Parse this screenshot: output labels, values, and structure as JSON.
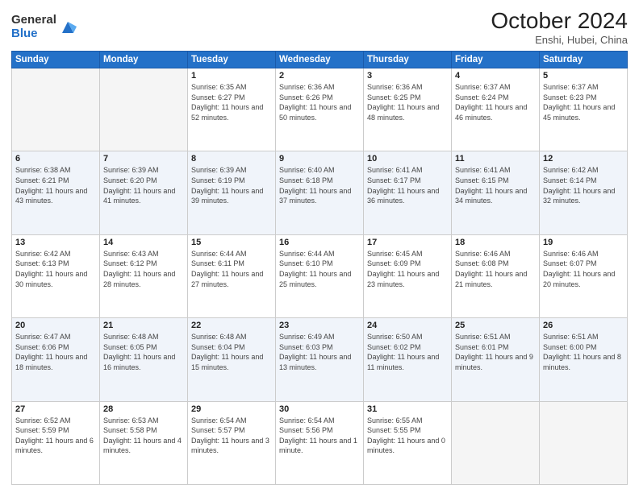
{
  "header": {
    "logo_general": "General",
    "logo_blue": "Blue",
    "title": "October 2024",
    "location": "Enshi, Hubei, China"
  },
  "weekdays": [
    "Sunday",
    "Monday",
    "Tuesday",
    "Wednesday",
    "Thursday",
    "Friday",
    "Saturday"
  ],
  "weeks": [
    [
      {
        "day": "",
        "info": ""
      },
      {
        "day": "",
        "info": ""
      },
      {
        "day": "1",
        "info": "Sunrise: 6:35 AM\nSunset: 6:27 PM\nDaylight: 11 hours and 52 minutes."
      },
      {
        "day": "2",
        "info": "Sunrise: 6:36 AM\nSunset: 6:26 PM\nDaylight: 11 hours and 50 minutes."
      },
      {
        "day": "3",
        "info": "Sunrise: 6:36 AM\nSunset: 6:25 PM\nDaylight: 11 hours and 48 minutes."
      },
      {
        "day": "4",
        "info": "Sunrise: 6:37 AM\nSunset: 6:24 PM\nDaylight: 11 hours and 46 minutes."
      },
      {
        "day": "5",
        "info": "Sunrise: 6:37 AM\nSunset: 6:23 PM\nDaylight: 11 hours and 45 minutes."
      }
    ],
    [
      {
        "day": "6",
        "info": "Sunrise: 6:38 AM\nSunset: 6:21 PM\nDaylight: 11 hours and 43 minutes."
      },
      {
        "day": "7",
        "info": "Sunrise: 6:39 AM\nSunset: 6:20 PM\nDaylight: 11 hours and 41 minutes."
      },
      {
        "day": "8",
        "info": "Sunrise: 6:39 AM\nSunset: 6:19 PM\nDaylight: 11 hours and 39 minutes."
      },
      {
        "day": "9",
        "info": "Sunrise: 6:40 AM\nSunset: 6:18 PM\nDaylight: 11 hours and 37 minutes."
      },
      {
        "day": "10",
        "info": "Sunrise: 6:41 AM\nSunset: 6:17 PM\nDaylight: 11 hours and 36 minutes."
      },
      {
        "day": "11",
        "info": "Sunrise: 6:41 AM\nSunset: 6:15 PM\nDaylight: 11 hours and 34 minutes."
      },
      {
        "day": "12",
        "info": "Sunrise: 6:42 AM\nSunset: 6:14 PM\nDaylight: 11 hours and 32 minutes."
      }
    ],
    [
      {
        "day": "13",
        "info": "Sunrise: 6:42 AM\nSunset: 6:13 PM\nDaylight: 11 hours and 30 minutes."
      },
      {
        "day": "14",
        "info": "Sunrise: 6:43 AM\nSunset: 6:12 PM\nDaylight: 11 hours and 28 minutes."
      },
      {
        "day": "15",
        "info": "Sunrise: 6:44 AM\nSunset: 6:11 PM\nDaylight: 11 hours and 27 minutes."
      },
      {
        "day": "16",
        "info": "Sunrise: 6:44 AM\nSunset: 6:10 PM\nDaylight: 11 hours and 25 minutes."
      },
      {
        "day": "17",
        "info": "Sunrise: 6:45 AM\nSunset: 6:09 PM\nDaylight: 11 hours and 23 minutes."
      },
      {
        "day": "18",
        "info": "Sunrise: 6:46 AM\nSunset: 6:08 PM\nDaylight: 11 hours and 21 minutes."
      },
      {
        "day": "19",
        "info": "Sunrise: 6:46 AM\nSunset: 6:07 PM\nDaylight: 11 hours and 20 minutes."
      }
    ],
    [
      {
        "day": "20",
        "info": "Sunrise: 6:47 AM\nSunset: 6:06 PM\nDaylight: 11 hours and 18 minutes."
      },
      {
        "day": "21",
        "info": "Sunrise: 6:48 AM\nSunset: 6:05 PM\nDaylight: 11 hours and 16 minutes."
      },
      {
        "day": "22",
        "info": "Sunrise: 6:48 AM\nSunset: 6:04 PM\nDaylight: 11 hours and 15 minutes."
      },
      {
        "day": "23",
        "info": "Sunrise: 6:49 AM\nSunset: 6:03 PM\nDaylight: 11 hours and 13 minutes."
      },
      {
        "day": "24",
        "info": "Sunrise: 6:50 AM\nSunset: 6:02 PM\nDaylight: 11 hours and 11 minutes."
      },
      {
        "day": "25",
        "info": "Sunrise: 6:51 AM\nSunset: 6:01 PM\nDaylight: 11 hours and 9 minutes."
      },
      {
        "day": "26",
        "info": "Sunrise: 6:51 AM\nSunset: 6:00 PM\nDaylight: 11 hours and 8 minutes."
      }
    ],
    [
      {
        "day": "27",
        "info": "Sunrise: 6:52 AM\nSunset: 5:59 PM\nDaylight: 11 hours and 6 minutes."
      },
      {
        "day": "28",
        "info": "Sunrise: 6:53 AM\nSunset: 5:58 PM\nDaylight: 11 hours and 4 minutes."
      },
      {
        "day": "29",
        "info": "Sunrise: 6:54 AM\nSunset: 5:57 PM\nDaylight: 11 hours and 3 minutes."
      },
      {
        "day": "30",
        "info": "Sunrise: 6:54 AM\nSunset: 5:56 PM\nDaylight: 11 hours and 1 minute."
      },
      {
        "day": "31",
        "info": "Sunrise: 6:55 AM\nSunset: 5:55 PM\nDaylight: 11 hours and 0 minutes."
      },
      {
        "day": "",
        "info": ""
      },
      {
        "day": "",
        "info": ""
      }
    ]
  ]
}
